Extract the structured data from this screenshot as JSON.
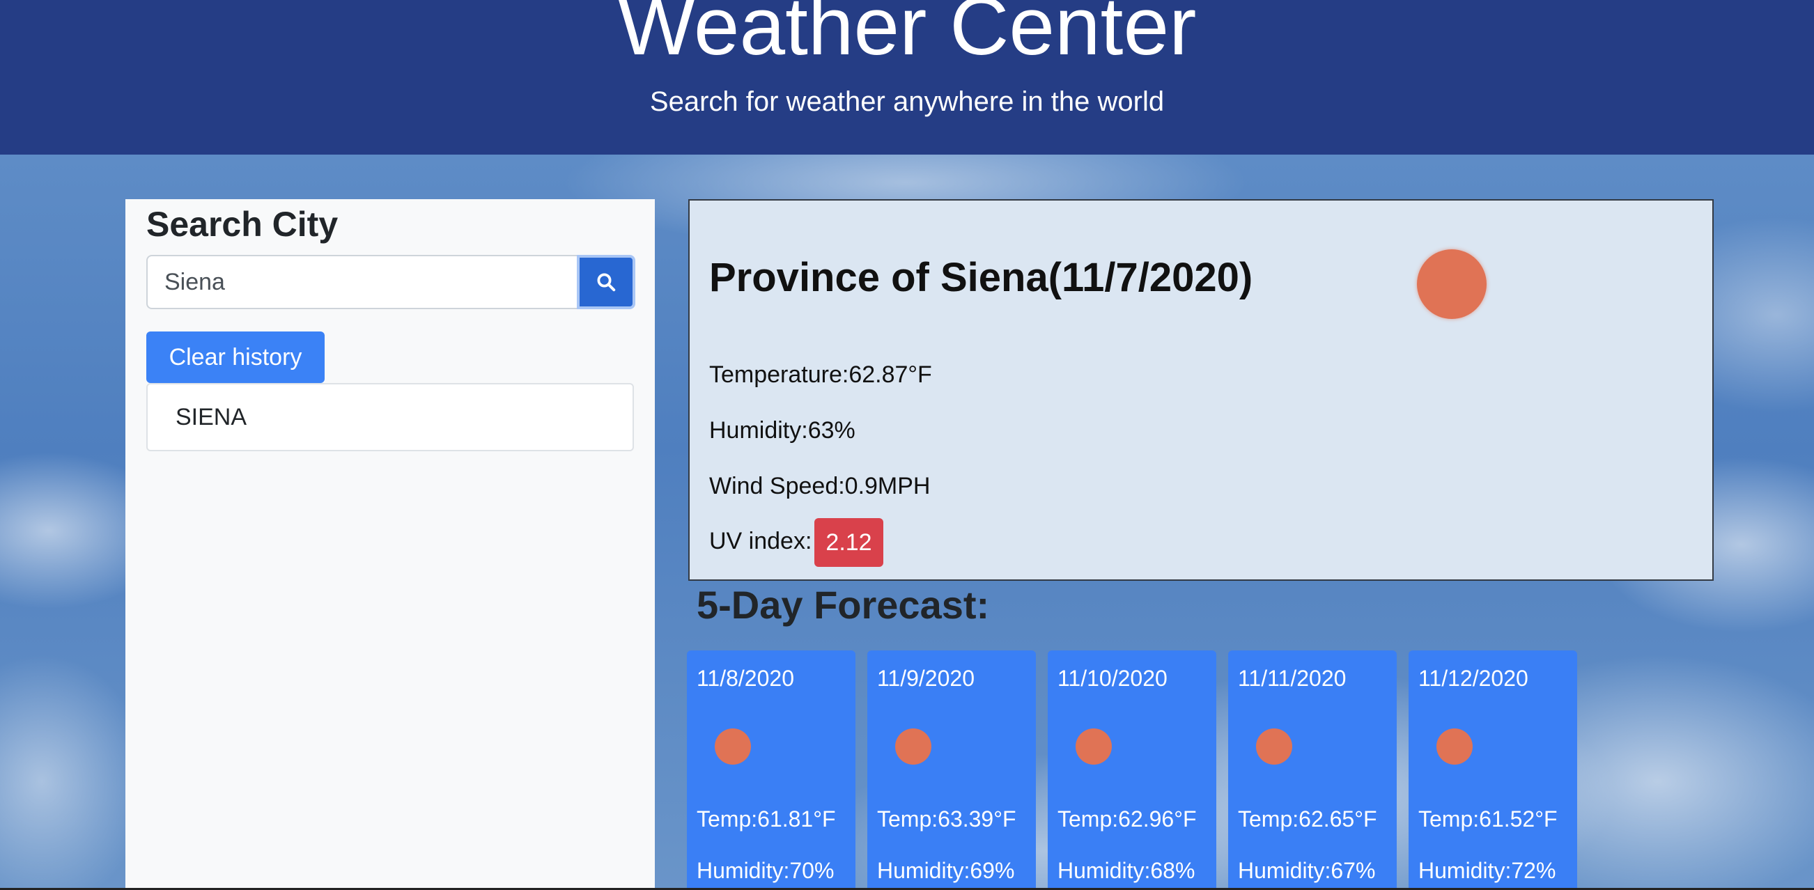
{
  "header": {
    "title": "Weather Center",
    "subtitle": "Search for weather anywhere in the world"
  },
  "search": {
    "title": "Search City",
    "value": "Siena",
    "placeholder": "",
    "button_icon": "search-icon",
    "clear_label": "Clear history",
    "history": [
      "SIENA"
    ]
  },
  "current": {
    "city_title": "Province of Siena(11/7/2020)",
    "temperature": "Temperature:62.87°F",
    "humidity": "Humidity:63%",
    "wind": "Wind Speed:0.9MPH",
    "uv_label": "UV index:",
    "uv_value": "2.12",
    "icon": "sun-icon",
    "uv_color": "#d9414b"
  },
  "forecast": {
    "title": "5-Day Forecast:",
    "days": [
      {
        "date": "11/8/2020",
        "temp": "Temp:61.81°F",
        "humidity": "Humidity:70%"
      },
      {
        "date": "11/9/2020",
        "temp": "Temp:63.39°F",
        "humidity": "Humidity:69%"
      },
      {
        "date": "11/10/2020",
        "temp": "Temp:62.96°F",
        "humidity": "Humidity:68%"
      },
      {
        "date": "11/11/2020",
        "temp": "Temp:62.65°F",
        "humidity": "Humidity:67%"
      },
      {
        "date": "11/12/2020",
        "temp": "Temp:61.52°F",
        "humidity": "Humidity:72%"
      }
    ]
  },
  "colors": {
    "header_bg": "#253d85",
    "accent": "#3a7ff5",
    "sun": "#e07355"
  }
}
